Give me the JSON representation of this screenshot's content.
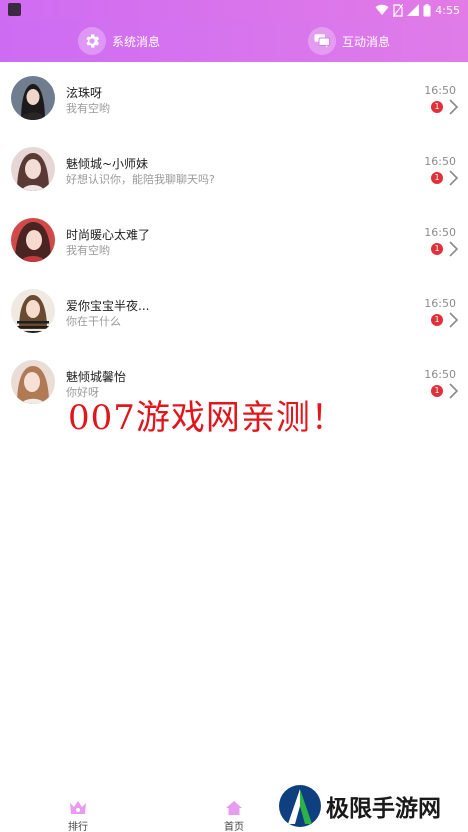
{
  "status_bar": {
    "time": "4:55"
  },
  "header": {
    "system_tab": {
      "label": "系统消息",
      "icon": "gear-icon"
    },
    "interact_tab": {
      "label": "互动消息",
      "icon": "chat-bubbles-icon"
    }
  },
  "messages": [
    {
      "name": "泫珠呀",
      "preview": "我有空哟",
      "time": "16:50",
      "unread": "1"
    },
    {
      "name": "魅倾城~小师妹",
      "preview": "好想认识你，能陪我聊聊天吗?",
      "time": "16:50",
      "unread": "1"
    },
    {
      "name": "时尚暖心太难了",
      "preview": "我有空哟",
      "time": "16:50",
      "unread": "1"
    },
    {
      "name": "爱你宝宝半夜...",
      "preview": "你在干什么",
      "time": "16:50",
      "unread": "1"
    },
    {
      "name": "魅倾城馨怡",
      "preview": "你好呀",
      "time": "16:50",
      "unread": "1"
    }
  ],
  "watermark": {
    "text": "007游戏网亲测！"
  },
  "bottom_nav": {
    "items": [
      {
        "label": "排行",
        "icon": "crown-icon"
      },
      {
        "label": "首页",
        "icon": "home-icon"
      }
    ]
  },
  "logo_watermark": {
    "text": "极限手游网"
  },
  "colors": {
    "accent": "#d873ee",
    "badge": "#e0313a",
    "watermark": "#e1161c"
  }
}
